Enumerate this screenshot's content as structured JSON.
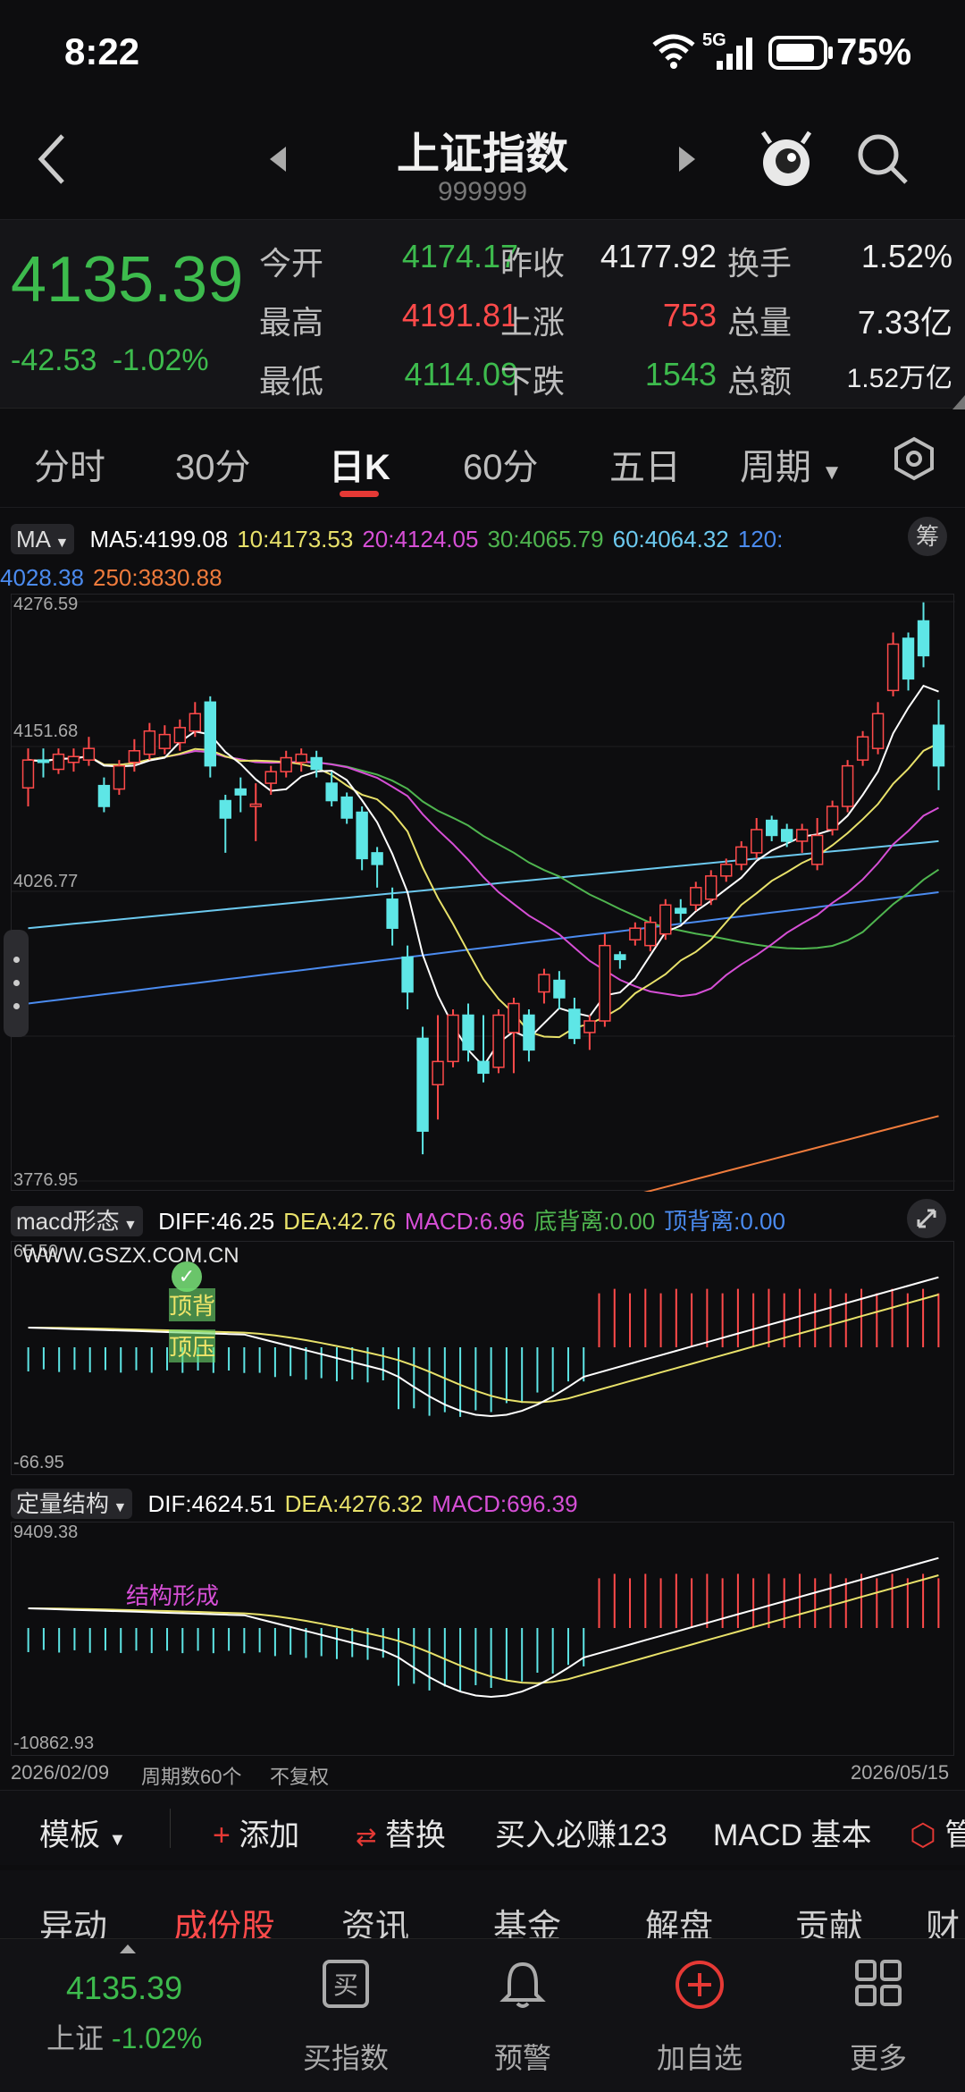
{
  "status_bar": {
    "time": "8:22",
    "battery": "75%",
    "network": "5G"
  },
  "header": {
    "title": "上证指数",
    "code": "999999"
  },
  "quote": {
    "price": "4135.39",
    "change": "-42.53",
    "change_pct": "-1.02%",
    "fields": [
      {
        "label": "今开",
        "value": "4174.17",
        "color": "green"
      },
      {
        "label": "昨收",
        "value": "4177.92",
        "color": "white"
      },
      {
        "label": "换手",
        "value": "1.52%",
        "color": "white"
      },
      {
        "label": "最高",
        "value": "4191.81",
        "color": "red"
      },
      {
        "label": "上涨",
        "value": "753",
        "color": "red"
      },
      {
        "label": "总量",
        "value": "7.33亿",
        "color": "white"
      },
      {
        "label": "最低",
        "value": "4114.09",
        "color": "green"
      },
      {
        "label": "下跌",
        "value": "1543",
        "color": "green"
      },
      {
        "label": "总额",
        "value": "1.52万亿",
        "color": "white"
      }
    ]
  },
  "tabs": [
    "分时",
    "30分",
    "日K",
    "60分",
    "五日",
    "周期"
  ],
  "active_tab": "日K",
  "ma_legend": {
    "selector": "MA",
    "items": [
      {
        "text": "MA5:4199.08",
        "color": "#ffffff"
      },
      {
        "text": "10:4173.53",
        "color": "#e8e16a"
      },
      {
        "text": "20:4124.05",
        "color": "#d64fd6"
      },
      {
        "text": "30:4065.79",
        "color": "#4fb54f"
      },
      {
        "text": "60:4064.32",
        "color": "#6cc9ef"
      },
      {
        "text": "120:",
        "color": "#4b8bef"
      },
      {
        "text": "4028.38",
        "color": "#4b8bef"
      },
      {
        "text": "250:3830.88",
        "color": "#ef7b3c"
      }
    ],
    "right_btn": "筹"
  },
  "price_axis": [
    "4276.59",
    "4151.68",
    "4026.77",
    "3776.95"
  ],
  "macd": {
    "selector": "macd形态",
    "items": [
      {
        "text": "DIFF:46.25",
        "color": "#ffffff"
      },
      {
        "text": "DEA:42.76",
        "color": "#e8e16a"
      },
      {
        "text": "MACD:6.96",
        "color": "#d64fd6"
      },
      {
        "text": "底背离:0.00",
        "color": "#4fb54f"
      },
      {
        "text": "顶背离:0.00",
        "color": "#4b8bef"
      }
    ],
    "top_label": "65.50",
    "bottom_label": "-66.95",
    "watermark": "WWW.GSZX.COM.CN",
    "tags": [
      "顶背",
      "顶压"
    ]
  },
  "struct": {
    "selector": "定量结构",
    "items": [
      {
        "text": "DIF:4624.51",
        "color": "#ffffff"
      },
      {
        "text": "DEA:4276.32",
        "color": "#e8e16a"
      },
      {
        "text": "MACD:696.39",
        "color": "#d64fd6"
      }
    ],
    "top_label": "9409.38",
    "bottom_label": "-10862.93",
    "tag": "结构形成"
  },
  "date_row": {
    "start": "2026/02/09",
    "period": "周期数60个",
    "adjust": "不复权",
    "end": "2026/05/15"
  },
  "toolbar": [
    "模板",
    "添加",
    "替换",
    "买入必赚123",
    "MACD 基本",
    "管"
  ],
  "subtabs": [
    "异动",
    "成份股",
    "资讯",
    "基金",
    "解盘",
    "贡献",
    "财"
  ],
  "active_subtab": "成份股",
  "bottom_nav": {
    "index_price": "4135.39",
    "index_name": "上证",
    "index_chg": "-1.02%",
    "items": [
      "买指数",
      "预警",
      "加自选",
      "更多"
    ]
  },
  "chart_data": {
    "type": "candlestick",
    "ylim": [
      3776.95,
      4276.59
    ],
    "candles": [
      [
        4116,
        4140,
        4100,
        4150
      ],
      [
        4140,
        4138,
        4125,
        4150
      ],
      [
        4132,
        4145,
        4128,
        4150
      ],
      [
        4138,
        4143,
        4130,
        4150
      ],
      [
        4140,
        4150,
        4135,
        4160
      ],
      [
        4118,
        4100,
        4095,
        4125
      ],
      [
        4115,
        4135,
        4110,
        4140
      ],
      [
        4138,
        4148,
        4130,
        4158
      ],
      [
        4145,
        4165,
        4140,
        4172
      ],
      [
        4150,
        4162,
        4145,
        4170
      ],
      [
        4155,
        4168,
        4148,
        4175
      ],
      [
        4165,
        4180,
        4160,
        4190
      ],
      [
        4190,
        4135,
        4125,
        4195
      ],
      [
        4105,
        4090,
        4060,
        4110
      ],
      [
        4115,
        4110,
        4095,
        4125
      ],
      [
        4100,
        4102,
        4070,
        4120
      ],
      [
        4120,
        4130,
        4110,
        4135
      ],
      [
        4130,
        4142,
        4125,
        4148
      ],
      [
        4138,
        4145,
        4130,
        4150
      ],
      [
        4142,
        4132,
        4125,
        4148
      ],
      [
        4120,
        4105,
        4100,
        4130
      ],
      [
        4108,
        4090,
        4085,
        4112
      ],
      [
        4095,
        4055,
        4045,
        4100
      ],
      [
        4060,
        4050,
        4030,
        4065
      ],
      [
        4020,
        3995,
        3980,
        4030
      ],
      [
        3970,
        3940,
        3925,
        3980
      ],
      [
        3900,
        3820,
        3800,
        3910
      ],
      [
        3860,
        3880,
        3830,
        3920
      ],
      [
        3880,
        3920,
        3875,
        3925
      ],
      [
        3920,
        3890,
        3880,
        3930
      ],
      [
        3880,
        3870,
        3862,
        3920
      ],
      [
        3875,
        3920,
        3870,
        3925
      ],
      [
        3905,
        3930,
        3870,
        3935
      ],
      [
        3920,
        3890,
        3880,
        3925
      ],
      [
        3940,
        3955,
        3930,
        3960
      ],
      [
        3950,
        3935,
        3925,
        3958
      ],
      [
        3925,
        3900,
        3895,
        3935
      ],
      [
        3905,
        3915,
        3890,
        3920
      ],
      [
        3915,
        3980,
        3910,
        3990
      ],
      [
        3972,
        3968,
        3960,
        3975
      ],
      [
        3985,
        3995,
        3980,
        4000
      ],
      [
        3980,
        4000,
        3975,
        4005
      ],
      [
        3990,
        4015,
        3985,
        4020
      ],
      [
        4012,
        4008,
        4000,
        4020
      ],
      [
        4015,
        4030,
        4010,
        4035
      ],
      [
        4020,
        4040,
        4015,
        4045
      ],
      [
        4040,
        4050,
        4035,
        4055
      ],
      [
        4050,
        4065,
        4045,
        4070
      ],
      [
        4060,
        4080,
        4055,
        4090
      ],
      [
        4088,
        4075,
        4070,
        4092
      ],
      [
        4080,
        4070,
        4065,
        4085
      ],
      [
        4070,
        4080,
        4060,
        4085
      ],
      [
        4050,
        4075,
        4045,
        4090
      ],
      [
        4080,
        4100,
        4075,
        4105
      ],
      [
        4100,
        4135,
        4095,
        4140
      ],
      [
        4140,
        4160,
        4135,
        4165
      ],
      [
        4150,
        4180,
        4145,
        4190
      ],
      [
        4200,
        4240,
        4195,
        4250
      ],
      [
        4245,
        4210,
        4200,
        4250
      ],
      [
        4260,
        4230,
        4220,
        4276
      ],
      [
        4170,
        4135,
        4114,
        4192
      ]
    ]
  }
}
